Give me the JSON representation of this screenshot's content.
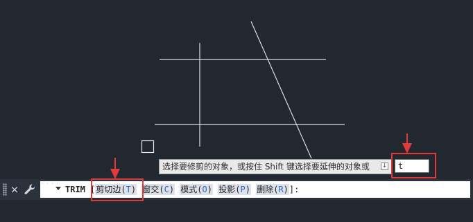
{
  "drawing": {
    "pick_box": "selection-pickbox"
  },
  "prompt": {
    "text": "选择要修剪的对象，或按住 Shift 键选择要延伸的对象或",
    "icon": "download-arrow-icon"
  },
  "dynamic_input": {
    "value": "t"
  },
  "highlight_color": "#e23a3a",
  "command_bar": {
    "close_icon": "×",
    "command_name": "TRIM",
    "bracket_open": "[",
    "options": [
      {
        "label": "剪切边",
        "key": "T"
      },
      {
        "label": "窗交",
        "key": "C"
      },
      {
        "label": "模式",
        "key": "O"
      },
      {
        "label": "投影",
        "key": "P"
      },
      {
        "label": "删除",
        "key": "R"
      }
    ],
    "bracket_close": "]:"
  }
}
